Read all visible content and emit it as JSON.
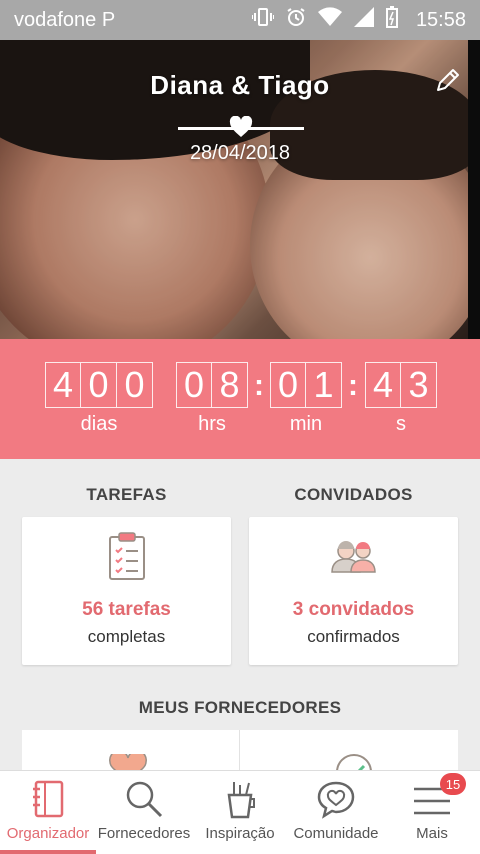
{
  "status_bar": {
    "carrier": "vodafone P",
    "time": "15:58"
  },
  "hero": {
    "couple_names": "Diana & Tiago",
    "wedding_date": "28/04/2018"
  },
  "countdown": {
    "days": [
      "4",
      "0",
      "0"
    ],
    "hours": [
      "0",
      "8"
    ],
    "minutes": [
      "0",
      "1"
    ],
    "seconds": [
      "4",
      "3"
    ],
    "labels": {
      "days": "dias",
      "hours": "hrs",
      "minutes": "min",
      "seconds": "s"
    }
  },
  "summary": {
    "tasks": {
      "title": "TAREFAS",
      "count": "56 tarefas",
      "desc": "completas"
    },
    "guests": {
      "title": "CONVIDADOS",
      "count": "3 convidados",
      "desc": "confirmados"
    }
  },
  "vendors": {
    "title": "MEUS FORNECEDORES"
  },
  "bottom_nav": {
    "items": [
      {
        "label": "Organizador",
        "icon": "notebook-icon",
        "active": true
      },
      {
        "label": "Fornecedores",
        "icon": "search-icon",
        "active": false
      },
      {
        "label": "Inspiração",
        "icon": "inspiration-cup-icon",
        "active": false
      },
      {
        "label": "Comunidade",
        "icon": "chat-heart-icon",
        "active": false
      },
      {
        "label": "Mais",
        "icon": "menu-icon",
        "active": false,
        "badge": "15"
      }
    ]
  },
  "colors": {
    "accent": "#f27a82",
    "accent_text": "#e26a70",
    "badge": "#e84a4f"
  }
}
